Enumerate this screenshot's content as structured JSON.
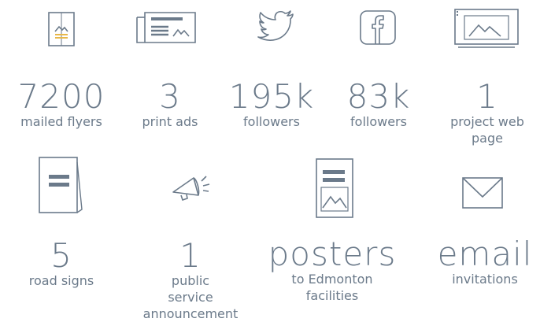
{
  "colors": {
    "stroke": "#6b7a8a",
    "accent": "#e8b84a",
    "text": "#6b7a8a"
  },
  "stats": [
    {
      "icon": "flyer-icon",
      "number": "7200",
      "label": "mailed flyers"
    },
    {
      "icon": "newspaper-icon",
      "number": "3",
      "label": "print ads"
    },
    {
      "icon": "twitter-icon",
      "number": "195k",
      "label": "followers"
    },
    {
      "icon": "facebook-icon",
      "number": "83k",
      "label": "followers"
    },
    {
      "icon": "web-page-icon",
      "number": "1",
      "label_line1": "project web",
      "label_line2": "page"
    },
    {
      "icon": "road-sign-icon",
      "number": "5",
      "label": "road signs"
    },
    {
      "icon": "megaphone-icon",
      "number": "1",
      "label_line1": "public",
      "label_line2": "service",
      "label_line3": "announcement"
    },
    {
      "icon": "poster-icon",
      "number": "posters",
      "label_line1": "to Edmonton",
      "label_line2": "facilities"
    },
    {
      "icon": "envelope-icon",
      "number": "email",
      "label": "invitations"
    }
  ]
}
